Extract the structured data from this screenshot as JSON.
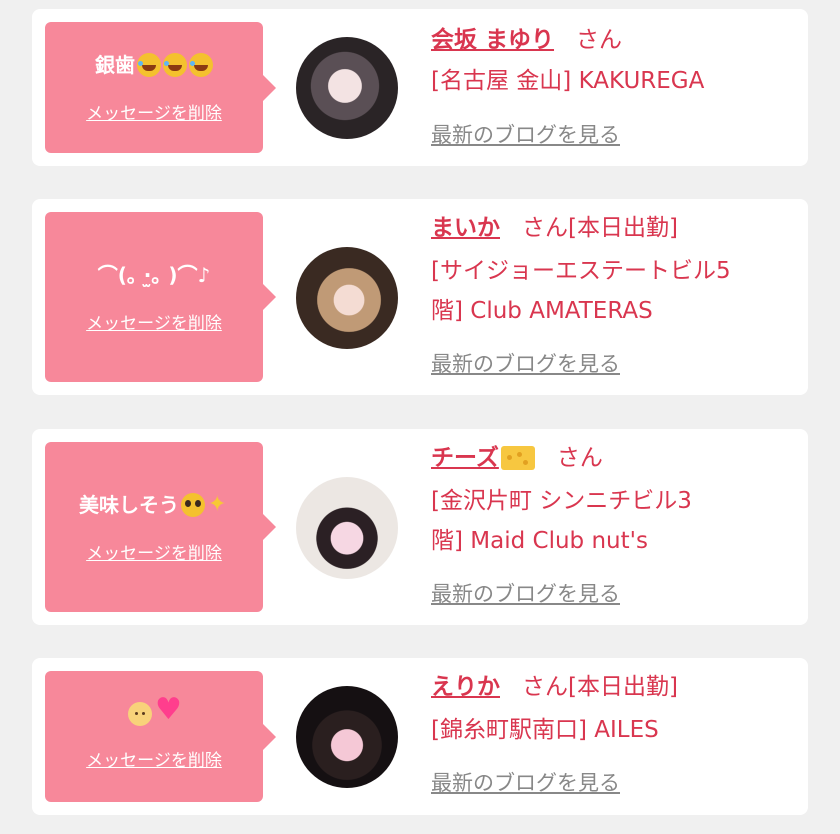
{
  "delete_label": "メッセージを削除",
  "blog_label": "最新のブログを見る",
  "san_label": "さん",
  "colors": {
    "accent": "#d9364f",
    "bubble": "#f7889a",
    "background": "#f0f0f0",
    "link_gray": "#888888"
  },
  "cards": [
    {
      "message": "銀歯",
      "message_icons": [
        "rolling-laughing-emoji",
        "rolling-laughing-emoji",
        "rolling-laughing-emoji"
      ],
      "name": "会坂 まゆり",
      "san": "さん",
      "shop_line1": "[名古屋 金山] KAKUREGA",
      "shop_line2": ""
    },
    {
      "message": "⌒(｡ ·̫｡ )⌒♪",
      "message_icons": [],
      "name": "まいか",
      "san": "さん[本日出勤]",
      "shop_line1": "[サイジョーエステートビル5",
      "shop_line2": "階] Club AMATERAS"
    },
    {
      "message": "美味しそう",
      "message_icons": [
        "pleading-face-emoji",
        "sparkles-emoji"
      ],
      "name": "チーズ",
      "name_icon": "cheese-emoji",
      "san": "さん",
      "shop_line1": "[金沢片町 シンニチビル3",
      "shop_line2": "階] Maid Club nut's"
    },
    {
      "message": "",
      "message_icons": [
        "baby-angel-emoji",
        "sparkling-heart-emoji"
      ],
      "name": "えりか",
      "san": "さん[本日出勤]",
      "shop_line1": "[錦糸町駅南口] AILES",
      "shop_line2": ""
    }
  ]
}
